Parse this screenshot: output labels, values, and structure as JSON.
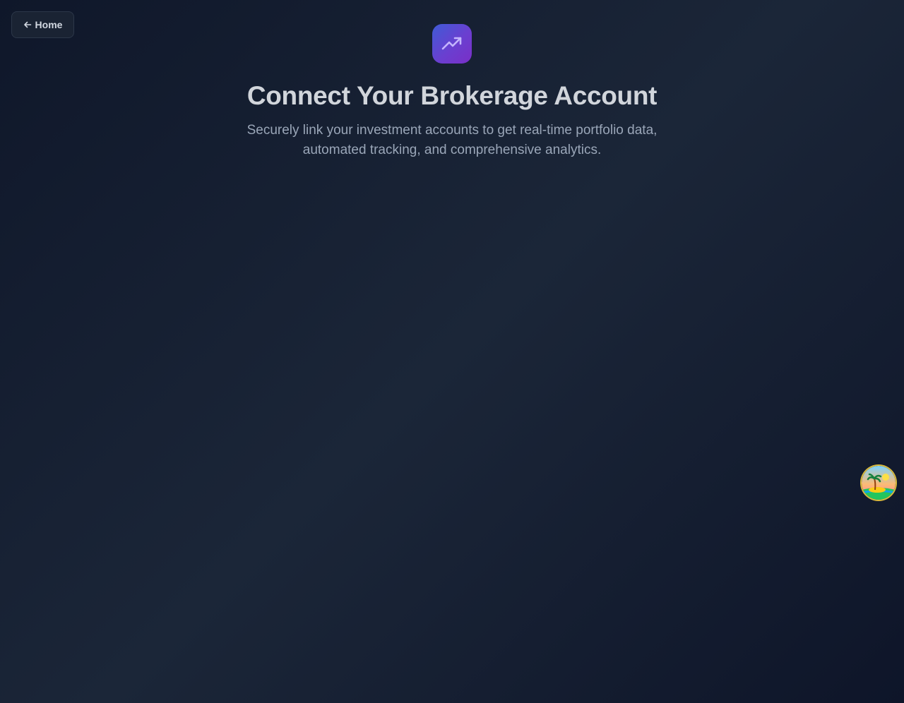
{
  "nav": {
    "home_label": "Home"
  },
  "header": {
    "title": "Connect Your Brokerage Account",
    "subtitle_line1": "Securely link your investment accounts to get real-time portfolio data,",
    "subtitle_line2": "automated tracking, and comprehensive analytics."
  },
  "icons": {
    "back": "arrow-left-icon",
    "logo": "trending-up-icon",
    "avatar": "island-avatar-icon"
  },
  "colors": {
    "background": "#131c2e",
    "logo_gradient_start": "#3f5bd6",
    "logo_gradient_end": "#7a2fc7",
    "title": "#d1d5db",
    "subtitle": "#9aa6b8"
  }
}
